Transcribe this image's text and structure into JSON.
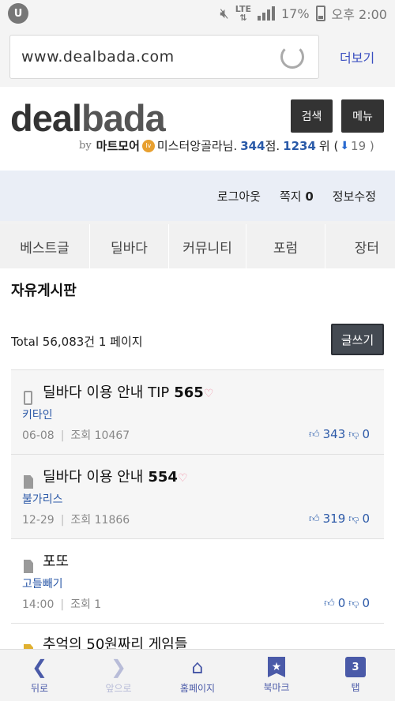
{
  "status": {
    "battery": "17%",
    "time": "오후 2:00",
    "network": "LTE"
  },
  "browser": {
    "url": "www.dealbada.com",
    "more_label": "더보기"
  },
  "site": {
    "logo_part1": "deal",
    "logo_part2": "bada",
    "by": "by",
    "sponsor": "마트모어",
    "username": "미스터앙골라님.",
    "points": "344",
    "points_unit": "점.",
    "rank": "1234",
    "rank_unit": "위 (",
    "rank_change": "19 )",
    "search_label": "검색",
    "menu_label": "메뉴"
  },
  "user_nav": {
    "logout": "로그아웃",
    "note_label": "쪽지",
    "note_count": "0",
    "edit_info": "정보수정"
  },
  "tabs": [
    "베스트글",
    "딜바다",
    "커뮤니티",
    "포럼",
    "장터"
  ],
  "board": {
    "title": "자유게시판",
    "total": "Total 56,083건 1 페이지",
    "write_label": "글쓰기",
    "views_label": "조회",
    "posts": [
      {
        "title": "딜바다 이용 안내 TIP",
        "comments": "565",
        "author": "키타인",
        "date": "06-08",
        "views": "10467",
        "likes": "343",
        "dislikes": "0"
      },
      {
        "title": "딜바다 이용 안내",
        "comments": "554",
        "author": "불가리스",
        "date": "12-29",
        "views": "11866",
        "likes": "319",
        "dislikes": "0"
      },
      {
        "title": "포또",
        "comments": "",
        "author": "고들빼기",
        "date": "14:00",
        "views": "1",
        "likes": "0",
        "dislikes": "0"
      },
      {
        "title": "추억의 50원짜리 게임들",
        "comments": "",
        "author": "",
        "date": "",
        "views": "",
        "likes": "",
        "dislikes": ""
      }
    ]
  },
  "bottom_nav": {
    "back": "뒤로",
    "forward": "앞으로",
    "home": "홈페이지",
    "bookmark": "북마크",
    "tabs": "탭",
    "tab_count": "3"
  },
  "colors": {
    "accent": "#4a5aa8",
    "link": "#2d5aa8",
    "dark_button": "#333333",
    "user_nav_bg": "#eaeef6"
  }
}
